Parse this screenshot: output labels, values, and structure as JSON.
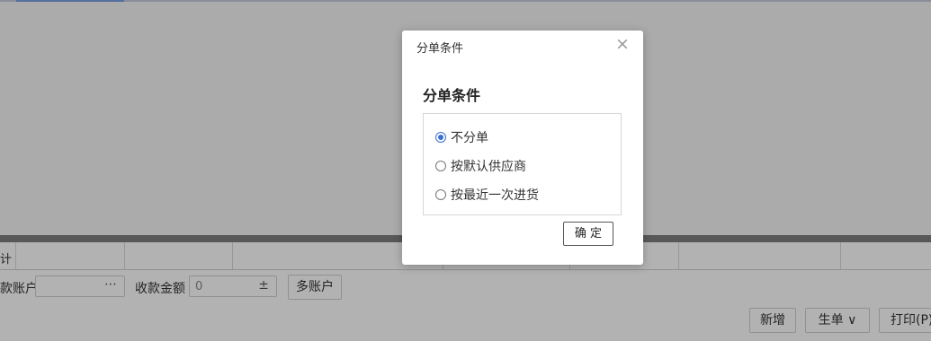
{
  "background": {
    "grid_header_first": "计",
    "footer": {
      "account_label": "款账户",
      "account_picker_icon": "⋯",
      "amount_label": "收款金额",
      "amount_value": "0",
      "amount_icon": "±",
      "multi_account_button": "多账户",
      "new_button": "新增",
      "generate_button": "生单 ∨",
      "print_button": "打印(P)"
    }
  },
  "dialog": {
    "title": "分单条件",
    "close_icon": "×",
    "heading": "分单条件",
    "options": [
      {
        "label": "不分单",
        "selected": true
      },
      {
        "label": "按默认供应商",
        "selected": false
      },
      {
        "label": "按最近一次进货",
        "selected": false
      }
    ],
    "confirm_label": "确 定"
  },
  "colors": {
    "radio_accent": "#3a6fd1",
    "overlay": "rgba(0,0,0,0.30)"
  }
}
